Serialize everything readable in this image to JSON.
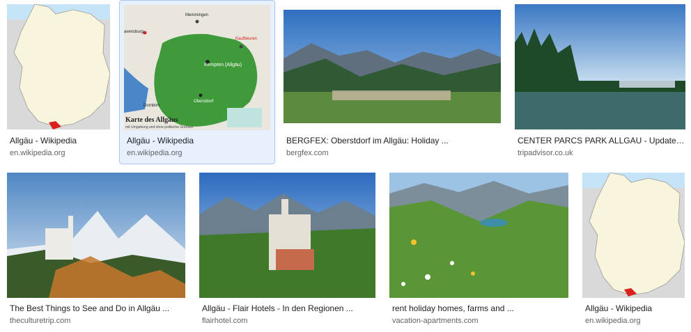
{
  "results": [
    {
      "title": "Allgäu - Wikipedia",
      "source": "en.wikipedia.org"
    },
    {
      "title": "Allgäu - Wikipedia",
      "source": "en.wikipedia.org",
      "selected": true
    },
    {
      "title": "BERGFEX: Oberstdorf im Allgäu: Holiday ...",
      "source": "bergfex.com"
    },
    {
      "title": "CENTER PARCS PARK ALLGAU - Updated ...",
      "source": "tripadvisor.co.uk"
    },
    {
      "title": "The Best Things to See and Do in Allgäu ...",
      "source": "theculturetrip.com"
    },
    {
      "title": "Allgäu - Flair Hotels - In den Regionen ...",
      "source": "flairhotel.com"
    },
    {
      "title": "rent holiday homes, farms and ...",
      "source": "vacation-apartments.com"
    },
    {
      "title": "Allgäu - Wikipedia",
      "source": "en.wikipedia.org"
    }
  ],
  "map_labels": {
    "title": "Karte des Allgäus",
    "subtitle": "mit Umgebung und ohne politische Grenzen",
    "city_kempten": "Kempten (Allgäu)",
    "city_memmingen": "Memmingen",
    "city_kaufbeuren": "Kaufbeuren",
    "city_ravensburg": "avensburg",
    "city_dornbirn": "Dornbirn",
    "city_oberstdorf": "Oberstdorf"
  },
  "colors": {
    "selected_bg": "#e8f0fe",
    "selected_border": "#a9c4f5",
    "title_text": "#202124",
    "source_text": "#5f6368",
    "map_green": "#3f9b3a",
    "germany_fill": "#f8f5dc",
    "allgau_red": "#d9221c"
  }
}
